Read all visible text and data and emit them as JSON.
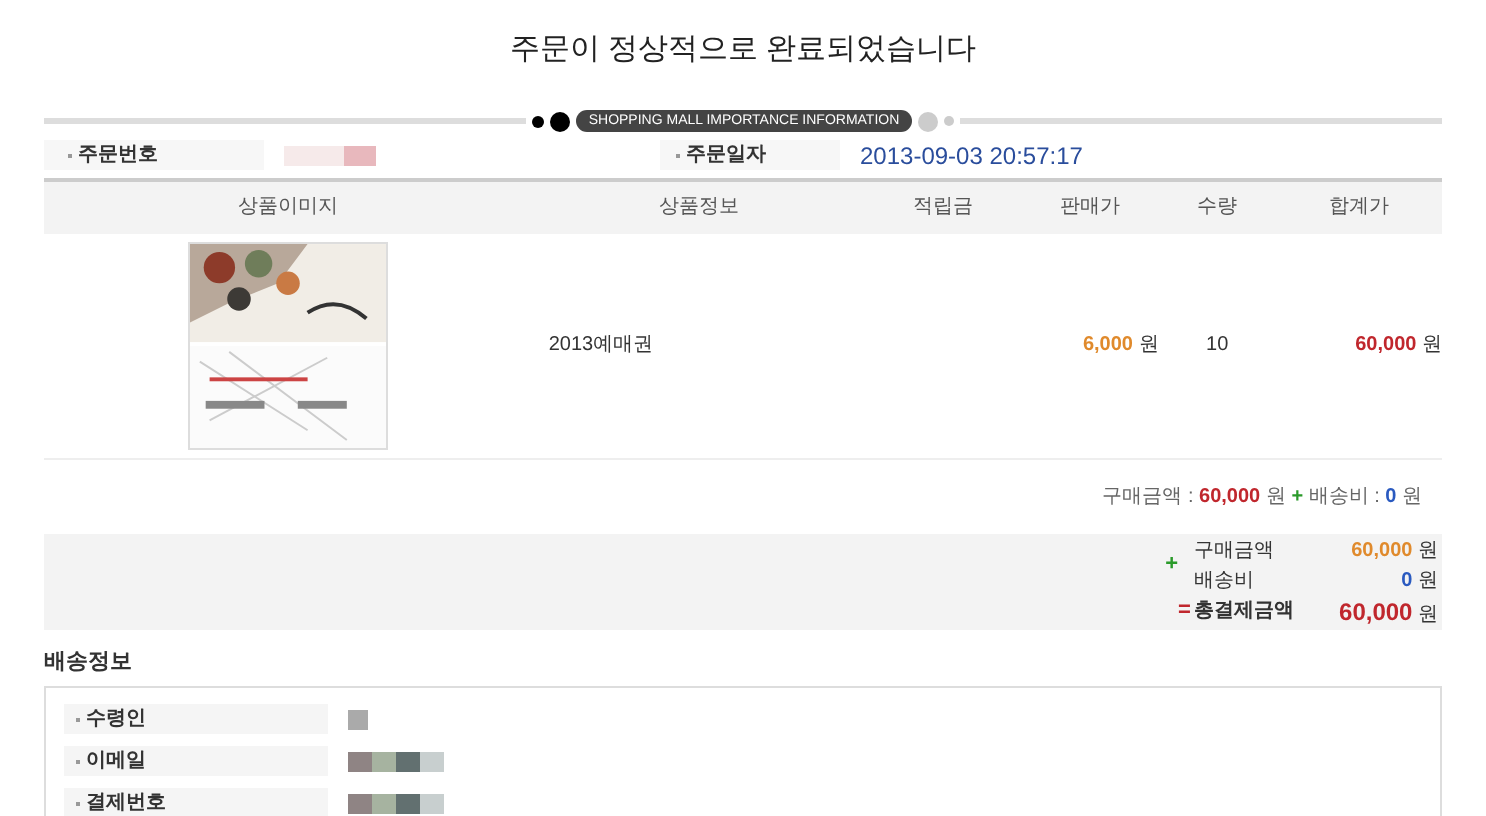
{
  "title": "주문이 정상적으로 완료되었습니다",
  "banner": "SHOPPING MALL IMPORTANCE INFORMATION",
  "order": {
    "number_label": "주문번호",
    "date_label": "주문일자",
    "date": "2013-09-03 20:57:17"
  },
  "table": {
    "columns": [
      "상품이미지",
      "상품정보",
      "적립금",
      "판매가",
      "수량",
      "합계가"
    ],
    "rows": [
      {
        "kind": "picture",
        "product": "2013예매권",
        "price": "6,000",
        "price_unit": "원",
        "qty": "10",
        "total": "60,000",
        "total_unit": "원"
      }
    ]
  },
  "summary_line": {
    "goods_label": "구매금액 :",
    "goods": "60,000",
    "goods_unit": "원",
    "plus": "+",
    "ship_label": "배송비 :",
    "ship": "0",
    "ship_unit": "원"
  },
  "totals": {
    "plus": "+",
    "equals": "=",
    "rows": [
      {
        "kind": "goods",
        "label": "구매금액",
        "value": "60,000",
        "unit": "원"
      },
      {
        "kind": "shipping",
        "label": "배송비",
        "value": "0",
        "unit": "원"
      },
      {
        "kind": "total",
        "label": "총결제금액",
        "value": "60,000",
        "unit": "원"
      }
    ]
  },
  "shipping": {
    "title": "배송정보",
    "fields": [
      {
        "label": "수령인"
      },
      {
        "label": "이메일"
      },
      {
        "label": "결제번호"
      }
    ]
  }
}
